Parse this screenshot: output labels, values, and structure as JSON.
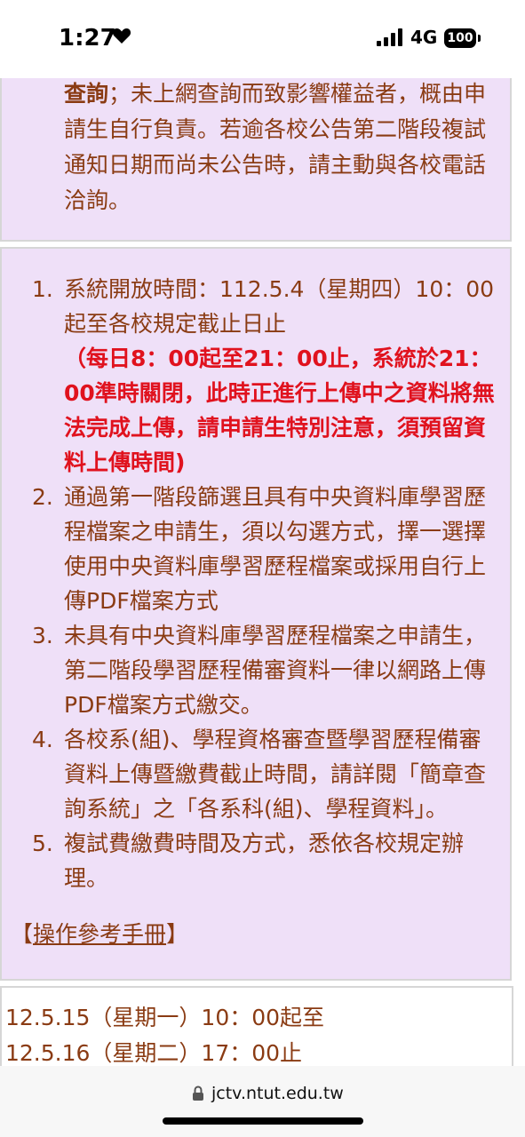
{
  "status_bar": {
    "time": "1:27",
    "network": "4G",
    "battery": "100"
  },
  "panel_a": {
    "bold_lead": "查詢",
    "text": "；未上網查詢而致影響權益者，概由申請生自行負責。若逾各校公告第二階段複試通知日期而尚未公告時，請主動與各校電話洽詢。"
  },
  "panel_b": {
    "items": [
      {
        "num": "1.",
        "text": "系統開放時間：112.5.4（星期四）10：00起至各校規定截止日止",
        "note": "（每日8：00起至21：00止，系統於21：00準時關閉，此時正進行上傳中之資料將無法完成上傳，請申請生特別注意，須預留資料上傳時間)"
      },
      {
        "num": "2.",
        "text": "通過第一階段篩選且具有中央資料庫學習歷程檔案之申請生，須以勾選方式，擇一選擇使用中央資料庫學習歷程檔案或採用自行上傳PDF檔案方式"
      },
      {
        "num": "3.",
        "text": "未具有中央資料庫學習歷程檔案之申請生，第二階段學習歷程備審資料一律以網路上傳PDF檔案方式繳交。"
      },
      {
        "num": "4.",
        "text": "各校系(組)、學程資格審查暨學習歷程備審資料上傳暨繳費截止時間，請詳閱「簡章查詢系統」之「各系科(組)、學程資料」。"
      },
      {
        "num": "5.",
        "text": "複試費繳費時間及方式，悉依各校規定辦理。"
      }
    ],
    "manual_open": "【",
    "manual_link": "操作參考手冊",
    "manual_close": "】"
  },
  "panel_c": {
    "line1": "12.5.15（星期一）10：00起至",
    "line2": "12.5.16（星期二）17：00止"
  },
  "address_bar": {
    "url": "jctv.ntut.edu.tw"
  }
}
